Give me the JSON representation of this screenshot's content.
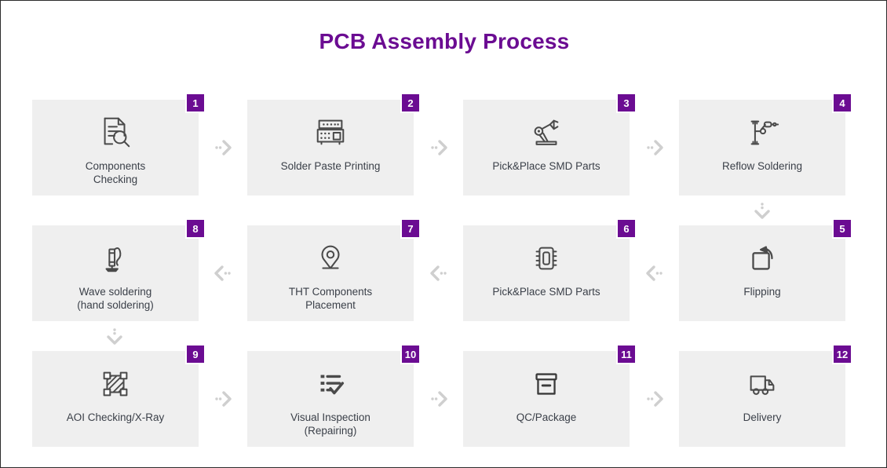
{
  "page": {
    "title": "PCB Assembly Process",
    "title_color": "#6b0c92",
    "background_color": "#ffffff",
    "card_background_color": "#efefef",
    "badge_color": "#6b0c92",
    "label_color": "#3b4049",
    "connector_color": "#cfcfcf"
  },
  "steps": [
    {
      "number": "1",
      "label": "Components\nChecking",
      "icon": "document-magnifier-icon",
      "row": 1,
      "column": 1
    },
    {
      "number": "2",
      "label": "Solder Paste Printing",
      "icon": "stencil-printer-icon",
      "row": 1,
      "column": 2
    },
    {
      "number": "3",
      "label": "Pick&Place SMD Parts",
      "icon": "robot-arm-icon",
      "row": 1,
      "column": 3
    },
    {
      "number": "4",
      "label": "Reflow Soldering",
      "icon": "reflow-machine-icon",
      "row": 1,
      "column": 4
    },
    {
      "number": "5",
      "label": "Flipping",
      "icon": "flip-rotate-icon",
      "row": 2,
      "column": 4
    },
    {
      "number": "6",
      "label": "Pick&Place SMD Parts",
      "icon": "ic-chip-icon",
      "row": 2,
      "column": 3
    },
    {
      "number": "7",
      "label": "THT Components\nPlacement",
      "icon": "map-pin-icon",
      "row": 2,
      "column": 2
    },
    {
      "number": "8",
      "label": "Wave soldering\n(hand soldering)",
      "icon": "soldering-iron-icon",
      "row": 2,
      "column": 1
    },
    {
      "number": "9",
      "label": "AOI Checking/X-Ray",
      "icon": "hatched-selection-icon",
      "row": 3,
      "column": 1
    },
    {
      "number": "10",
      "label": "Visual Inspection\n(Repairing)",
      "icon": "checklist-icon",
      "row": 3,
      "column": 2
    },
    {
      "number": "11",
      "label": "QC/Package",
      "icon": "package-box-icon",
      "row": 3,
      "column": 3
    },
    {
      "number": "12",
      "label": "Delivery",
      "icon": "delivery-truck-icon",
      "row": 3,
      "column": 4
    }
  ],
  "connectors": [
    {
      "direction": "right",
      "from": "1",
      "to": "2"
    },
    {
      "direction": "right",
      "from": "2",
      "to": "3"
    },
    {
      "direction": "right",
      "from": "3",
      "to": "4"
    },
    {
      "direction": "down",
      "from": "4",
      "to": "5"
    },
    {
      "direction": "left",
      "from": "5",
      "to": "6"
    },
    {
      "direction": "left",
      "from": "6",
      "to": "7"
    },
    {
      "direction": "left",
      "from": "7",
      "to": "8"
    },
    {
      "direction": "down",
      "from": "8",
      "to": "9"
    },
    {
      "direction": "right",
      "from": "9",
      "to": "10"
    },
    {
      "direction": "right",
      "from": "10",
      "to": "11"
    },
    {
      "direction": "right",
      "from": "11",
      "to": "12"
    }
  ]
}
